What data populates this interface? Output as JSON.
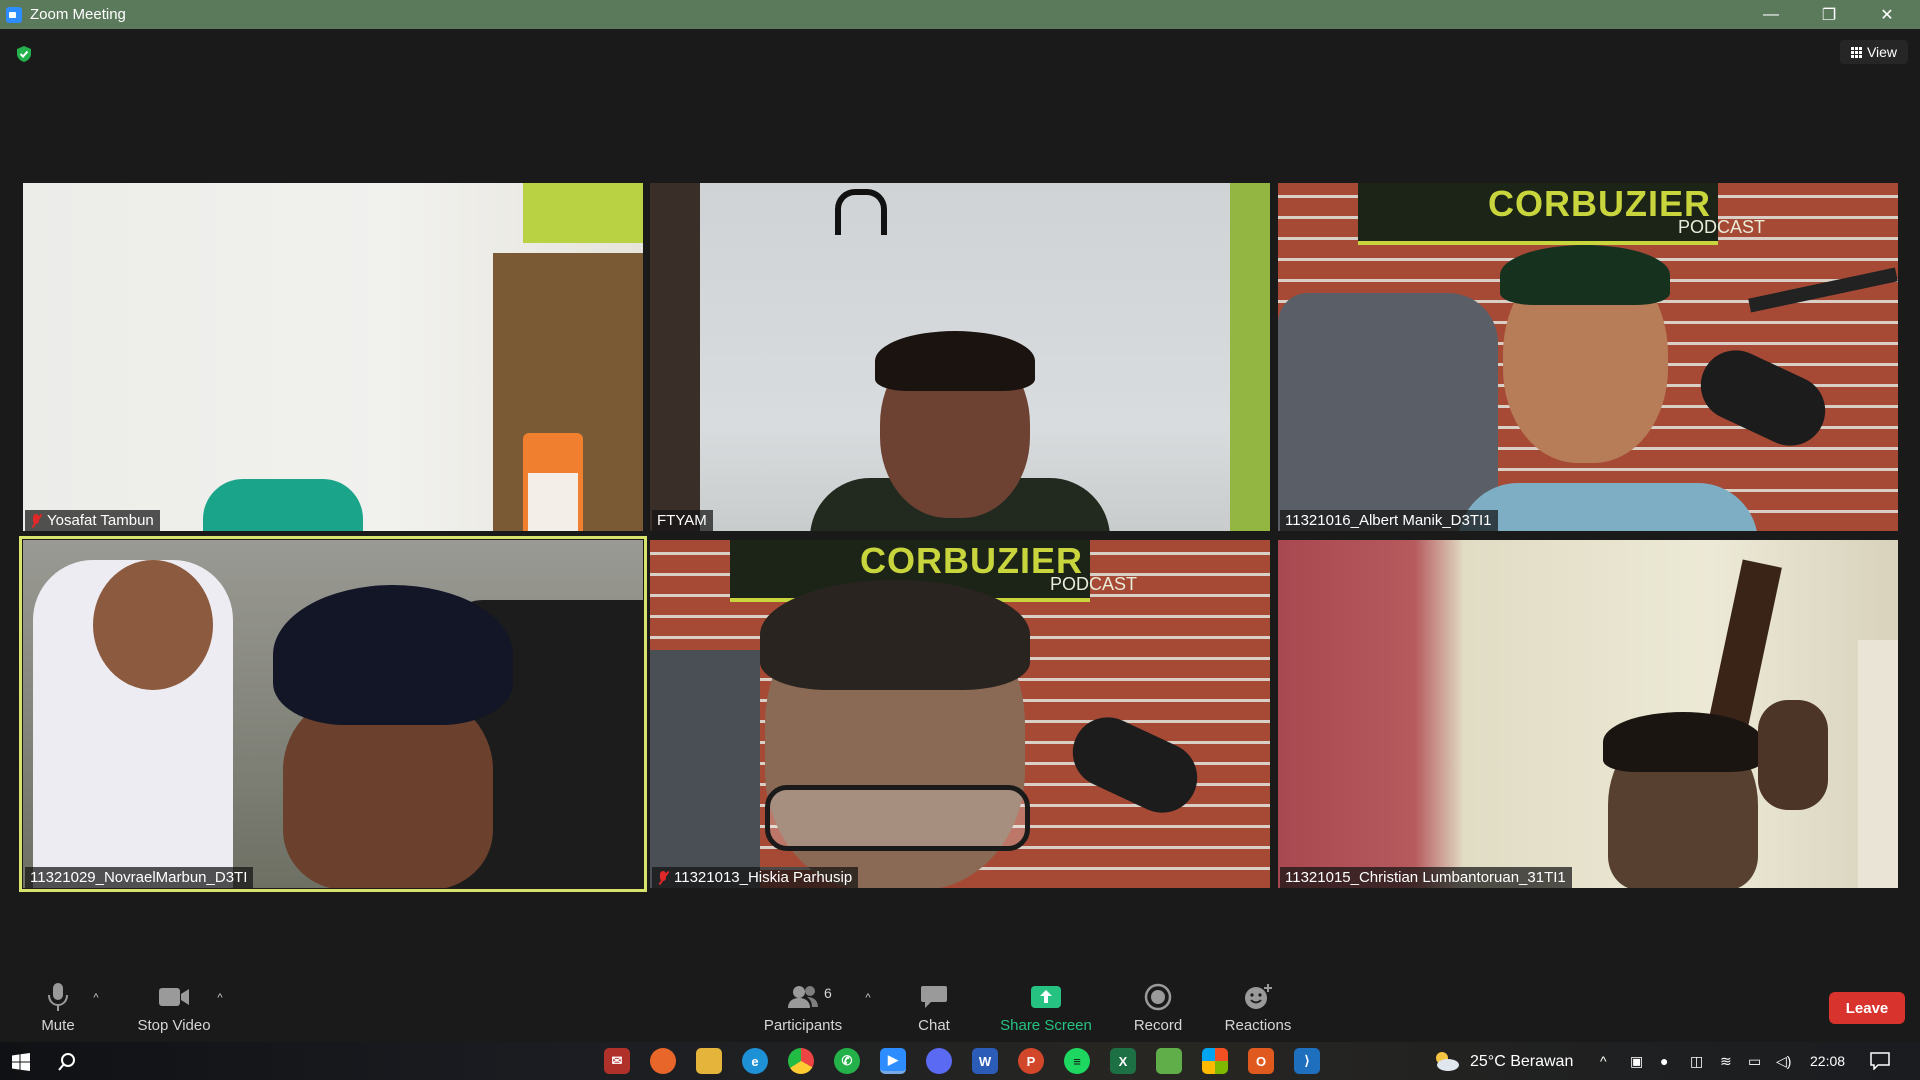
{
  "window": {
    "title": "Zoom Meeting",
    "controls": {
      "minimize": "—",
      "maximize": "❐",
      "close": "✕"
    }
  },
  "top": {
    "view_label": "View"
  },
  "participants_tiles": [
    {
      "name": "Yosafat Tambun",
      "muted": true
    },
    {
      "name": "FTYAM",
      "muted": false
    },
    {
      "name": "11321016_Albert Manik_D3TI1",
      "muted": false
    },
    {
      "name": "11321029_NovraelMarbun_D3TI",
      "muted": false,
      "active_speaker": true
    },
    {
      "name": "11321013_Hiskia Parhusip",
      "muted": true
    },
    {
      "name": "11321015_Christian Lumbantoruan_31TI1",
      "muted": false
    }
  ],
  "banner": {
    "title": "CORBUZIER",
    "subtitle": "PODCAST"
  },
  "toolbar": {
    "mute": "Mute",
    "stop_video": "Stop Video",
    "participants": "Participants",
    "participants_count": "6",
    "chat": "Chat",
    "share_screen": "Share Screen",
    "record": "Record",
    "reactions": "Reactions",
    "leave": "Leave"
  },
  "taskbar": {
    "weather": "25°C  Berawan",
    "time": "22:08",
    "apps": [
      "start",
      "search",
      "mail",
      "firefox",
      "explorer",
      "edge",
      "chrome",
      "whatsapp",
      "zoom",
      "discord",
      "word",
      "powerpoint",
      "spotify",
      "excel",
      "notepad",
      "store",
      "ms-office",
      "vscode"
    ]
  },
  "colors": {
    "titlebar": "#5b7a5c",
    "active_speaker": "#d7e36a",
    "leave": "#d8332c",
    "share": "#26c281"
  }
}
